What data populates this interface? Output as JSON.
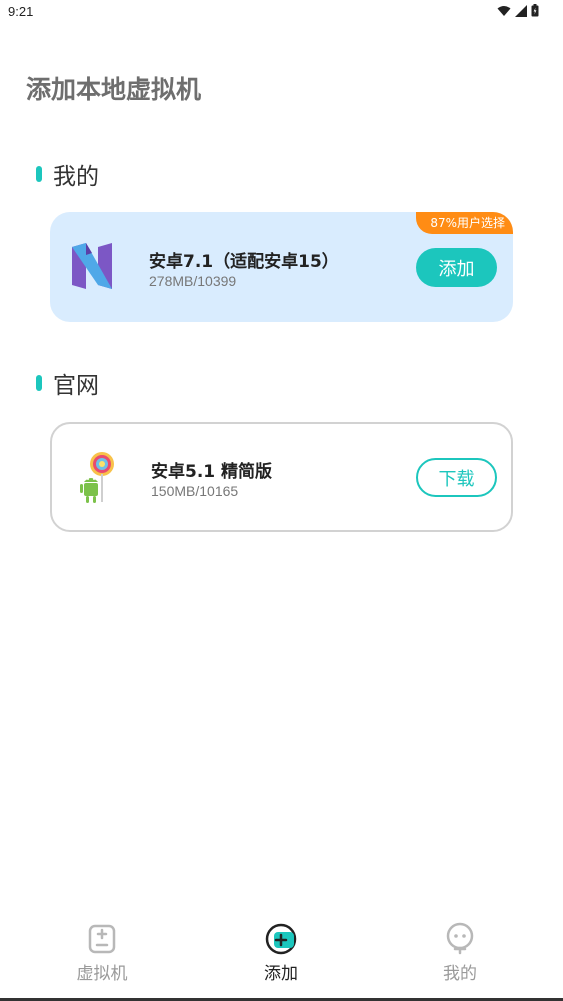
{
  "status_bar": {
    "time": "9:21"
  },
  "page": {
    "title": "添加本地虚拟机"
  },
  "sections": {
    "mine": {
      "label": "我的",
      "card": {
        "badge": "87%用户选择",
        "name": "安卓7.1（适配安卓15）",
        "size": "278MB/10399",
        "action_label": "添加",
        "logo_icon": "android-nougat-logo-icon"
      }
    },
    "official": {
      "label": "官网",
      "card": {
        "name": "安卓5.1 精简版",
        "size": "150MB/10165",
        "action_label": "下载",
        "logo_icon": "android-lollipop-logo-icon"
      }
    }
  },
  "bottom_nav": {
    "items": [
      {
        "label": "虚拟机",
        "icon": "virtual-machine-icon",
        "active": false
      },
      {
        "label": "添加",
        "icon": "add-icon",
        "active": true
      },
      {
        "label": "我的",
        "icon": "profile-icon",
        "active": false
      }
    ]
  },
  "colors": {
    "accent": "#1cc6bd",
    "badge": "#ff8c14",
    "card_mine_bg": "#d9ecfe"
  }
}
